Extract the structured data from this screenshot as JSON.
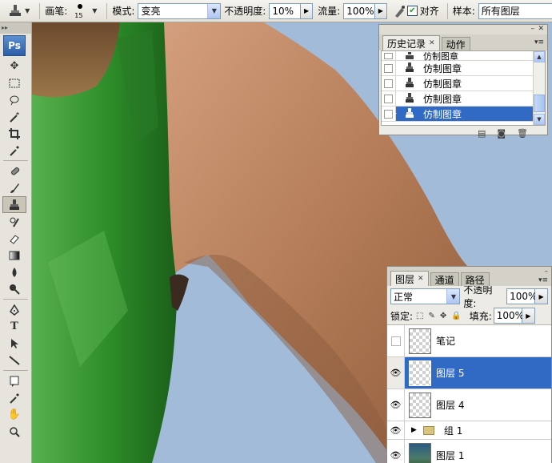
{
  "options_bar": {
    "brush_label": "画笔:",
    "brush_size": "15",
    "mode_label": "模式:",
    "mode_value": "变亮",
    "opacity_label": "不透明度:",
    "opacity_value": "10%",
    "flow_label": "流量:",
    "flow_value": "100%",
    "aligned_label": "对齐",
    "aligned_checked": true,
    "sample_label": "样本:",
    "sample_value": "所有图层"
  },
  "toolbox": {
    "logo": "Ps",
    "tools": [
      "move-tool-icon",
      "marquee-tool-icon",
      "lasso-tool-icon",
      "magic-wand-tool-icon",
      "crop-tool-icon",
      "eyedropper-tool-icon",
      "healing-brush-tool-icon",
      "brush-tool-icon",
      "clone-stamp-tool-icon",
      "history-brush-tool-icon",
      "eraser-tool-icon",
      "gradient-tool-icon",
      "blur-tool-icon",
      "dodge-tool-icon",
      "pen-tool-icon",
      "type-tool-icon",
      "path-selection-tool-icon",
      "line-tool-icon",
      "notes-tool-icon",
      "eyedropper2-tool-icon",
      "hand-tool-icon",
      "zoom-tool-icon"
    ],
    "active_tool": "clone-stamp-tool-icon"
  },
  "history_panel": {
    "tabs": [
      {
        "label": "历史记录"
      },
      {
        "label": "动作"
      }
    ],
    "items": [
      {
        "label": "仿制图章"
      },
      {
        "label": "仿制图章"
      },
      {
        "label": "仿制图章"
      },
      {
        "label": "仿制图章"
      },
      {
        "label": "仿制图章",
        "selected": true
      }
    ]
  },
  "layers_panel": {
    "tabs": [
      {
        "label": "图层"
      },
      {
        "label": "通道"
      },
      {
        "label": "路径"
      }
    ],
    "blend_mode": "正常",
    "opacity_label": "不透明度:",
    "opacity_value": "100%",
    "lock_label": "锁定:",
    "fill_label": "填充:",
    "fill_value": "100%",
    "layers": [
      {
        "name": "笔记",
        "visible": false,
        "selected": false,
        "type": "layer"
      },
      {
        "name": "图层 5",
        "visible": true,
        "selected": true,
        "type": "layer"
      },
      {
        "name": "图层 4",
        "visible": true,
        "selected": false,
        "type": "layer"
      },
      {
        "name": "组 1",
        "visible": true,
        "selected": false,
        "type": "group"
      },
      {
        "name": "图层 1",
        "visible": true,
        "selected": false,
        "type": "photo"
      }
    ]
  },
  "colors": {
    "selection": "#316ac5",
    "sky": "#9db7d6",
    "skin": "#b07a55",
    "shirt": "#2f8a2b"
  }
}
